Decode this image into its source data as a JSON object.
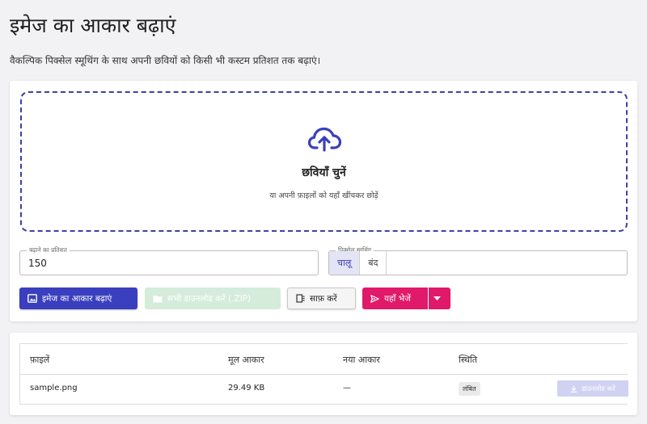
{
  "header": {
    "title": "इमेज का आकार बढ़ाएं",
    "subtitle": "वैकल्पिक पिक्सेल स्मूथिंग के साथ अपनी छवियों को किसी भी कस्टम प्रतिशत तक बढ़ाएं।"
  },
  "dropzone": {
    "icon": "cloud-upload-icon",
    "title": "छवियाँ चुनें",
    "hint": "या अपनी फ़ाइलों को यहाँ खींचकर छोड़ें"
  },
  "settings": {
    "percent_label": "बढ़ाने का प्रतिशत",
    "percent_value": "150",
    "smoothing_label": "पिक्सेल स्मूथिंग",
    "smoothing_on": "चालू",
    "smoothing_off": "बंद",
    "smoothing_selected": "चालू"
  },
  "actions": {
    "enlarge": "इमेज का आकार बढ़ाएं",
    "download_all": "सभी डाउनलोड करें (.ZIP)",
    "clear": "साफ़ करें",
    "send": "यहाँ भेजें"
  },
  "table": {
    "headers": [
      "फ़ाइलें",
      "मूल आकार",
      "नया आकार",
      "स्थिति"
    ],
    "rows": [
      {
        "file": "sample.png",
        "original_size": "29.49 KB",
        "new_size": "—",
        "status": "लंबित",
        "action": "डाउनलोड करें"
      }
    ]
  },
  "colors": {
    "primary": "#3a3fbf",
    "accent": "#e0196a",
    "success_disabled": "#d4ecd9"
  }
}
